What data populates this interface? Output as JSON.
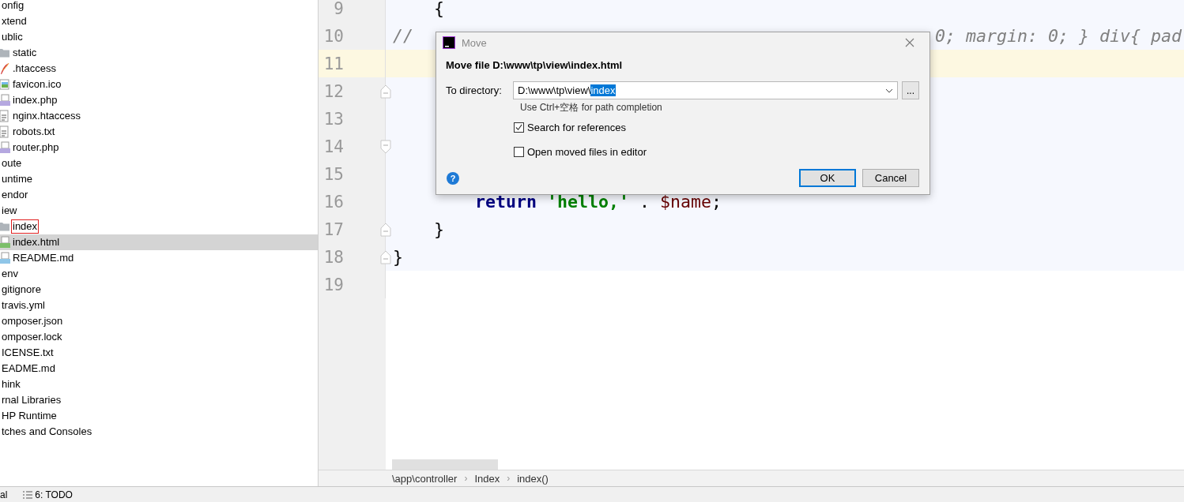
{
  "project_tree": [
    {
      "label": "onfig",
      "selected": false,
      "drop_target": false
    },
    {
      "label": "xtend",
      "selected": false,
      "drop_target": false
    },
    {
      "label": "ublic",
      "selected": false,
      "drop_target": false,
      "children": [
        {
          "label": "static",
          "kind": "folder",
          "selected": false,
          "drop_target": false
        },
        {
          "label": ".htaccess",
          "kind": "feather",
          "selected": false,
          "drop_target": false
        },
        {
          "label": "favicon.ico",
          "kind": "image",
          "selected": false,
          "drop_target": false
        },
        {
          "label": "index.php",
          "kind": "php",
          "selected": false,
          "drop_target": false
        },
        {
          "label": "nginx.htaccess",
          "kind": "text",
          "selected": false,
          "drop_target": false
        },
        {
          "label": "robots.txt",
          "kind": "text",
          "selected": false,
          "drop_target": false
        },
        {
          "label": "router.php",
          "kind": "php",
          "selected": false,
          "drop_target": false
        }
      ]
    },
    {
      "label": "oute",
      "selected": false,
      "drop_target": false
    },
    {
      "label": "untime",
      "selected": false,
      "drop_target": false
    },
    {
      "label": "endor",
      "selected": false,
      "drop_target": false
    },
    {
      "label": "iew",
      "selected": false,
      "drop_target": false,
      "children": [
        {
          "label": "index",
          "kind": "folder",
          "selected": false,
          "drop_target": true
        },
        {
          "label": "index.html",
          "kind": "html",
          "selected": true,
          "drop_target": false
        },
        {
          "label": "README.md",
          "kind": "md",
          "selected": false,
          "drop_target": false
        }
      ]
    },
    {
      "label": "env",
      "selected": false,
      "drop_target": false
    },
    {
      "label": "gitignore",
      "selected": false,
      "drop_target": false
    },
    {
      "label": "travis.yml",
      "selected": false,
      "drop_target": false
    },
    {
      "label": "omposer.json",
      "selected": false,
      "drop_target": false
    },
    {
      "label": "omposer.lock",
      "selected": false,
      "drop_target": false
    },
    {
      "label": "ICENSE.txt",
      "selected": false,
      "drop_target": false
    },
    {
      "label": "EADME.md",
      "selected": false,
      "drop_target": false
    },
    {
      "label": "hink",
      "selected": false,
      "drop_target": false
    },
    {
      "label": "rnal Libraries",
      "selected": false,
      "drop_target": false
    },
    {
      "label": "HP Runtime",
      "selected": false,
      "drop_target": false
    },
    {
      "label": "tches and Consoles",
      "selected": false,
      "drop_target": false
    }
  ],
  "editor": {
    "lines": [
      {
        "number": "9",
        "current": false,
        "scope": true,
        "tokens": [
          {
            "text": "    {",
            "kind": "plain"
          }
        ]
      },
      {
        "number": "10",
        "current": false,
        "scope": true,
        "tokens": [
          {
            "text": "//",
            "kind": "comment"
          },
          {
            "text": "0; margin: 0; } div{ pad",
            "kind": "comment_tail"
          }
        ]
      },
      {
        "number": "11",
        "current": true,
        "scope": true
      },
      {
        "number": "12",
        "current": false,
        "scope": true,
        "kind": "fold_end"
      },
      {
        "number": "13",
        "current": false,
        "scope": true
      },
      {
        "number": "14",
        "current": false,
        "scope": true,
        "kind": "fold_start"
      },
      {
        "number": "15",
        "current": false,
        "scope": true
      },
      {
        "number": "16",
        "current": false,
        "scope": true,
        "tokens": [
          {
            "text": "        return",
            "kind": "keyword"
          },
          {
            "text": " 'hello,'",
            "kind": "string"
          },
          {
            "text": " . ",
            "kind": "plain"
          },
          {
            "text": "$name",
            "kind": "variable"
          },
          {
            "text": ";",
            "kind": "plain"
          }
        ]
      },
      {
        "number": "17",
        "current": false,
        "scope": true,
        "kind": "fold_end",
        "tokens": [
          {
            "text": "    }",
            "kind": "plain"
          }
        ]
      },
      {
        "number": "18",
        "current": false,
        "scope": true,
        "kind": "fold_end",
        "tokens": [
          {
            "text": "}",
            "kind": "plain"
          }
        ]
      },
      {
        "number": "19",
        "current": false,
        "scope": false
      }
    ]
  },
  "breadcrumbs": [
    {
      "label": "\\app\\controller"
    },
    {
      "separator": "›",
      "label": "Index"
    },
    {
      "separator": "›",
      "label": "index()"
    }
  ],
  "status_bar": {
    "items": [
      {
        "label": "al"
      },
      {
        "kind": "list",
        "label": "6: TODO"
      }
    ]
  },
  "dialog": {
    "title": "Move",
    "heading": "Move file D:\\www\\tp\\view\\index.html",
    "directory_label": "To directory:",
    "directory_field": {
      "value": "D:\\www\\tp\\view\\",
      "selected_part": "index"
    },
    "browse_button": "...",
    "hint": "Use Ctrl+空格 for path completion",
    "options": [
      {
        "label": "Search for references",
        "checked": true
      },
      {
        "label": "Open moved files in editor",
        "checked": false
      }
    ],
    "help": "?",
    "buttons": [
      {
        "label": "OK",
        "default": true
      },
      {
        "label": "Cancel",
        "default": false
      }
    ]
  }
}
